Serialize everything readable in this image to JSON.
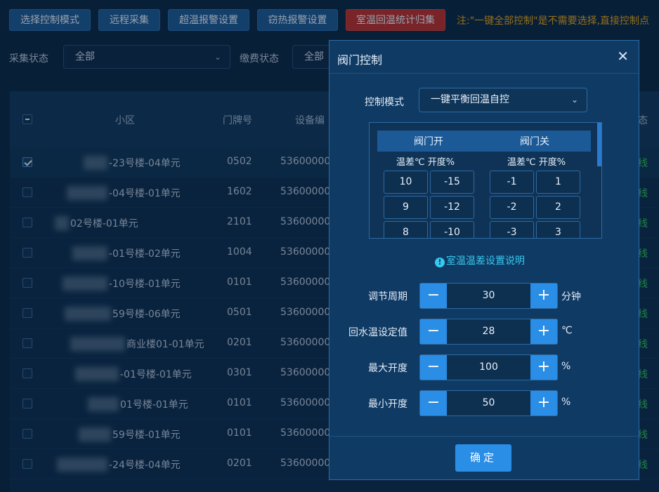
{
  "toolbar": {
    "buttons": [
      {
        "label": "选择控制模式"
      },
      {
        "label": "远程采集"
      },
      {
        "label": "超温报警设置"
      },
      {
        "label": "窃热报警设置"
      },
      {
        "label": "室温回温统计归集"
      }
    ],
    "note": "注:\"一键全部控制\"是不需要选择,直接控制点"
  },
  "filters": {
    "collect_label": "采集状态",
    "collect_value": "全部",
    "pay_label": "缴费状态",
    "pay_value": "全部"
  },
  "table": {
    "headers": {
      "community": "小区",
      "door": "门牌号",
      "device": "设备编",
      "status": "态"
    },
    "rows": [
      {
        "community": "-23号楼-04单元",
        "door": "0502",
        "device": "53600000",
        "status": "线",
        "checked": true
      },
      {
        "community": "-04号楼-01单元",
        "door": "1602",
        "device": "53600000",
        "status": "线",
        "checked": false
      },
      {
        "community": "02号楼-01单元",
        "door": "2101",
        "device": "53600000",
        "status": "线",
        "checked": false
      },
      {
        "community": "-01号楼-02单元",
        "door": "1004",
        "device": "53600000",
        "status": "线",
        "checked": false
      },
      {
        "community": "-10号楼-01单元",
        "door": "0101",
        "device": "53600000",
        "status": "线",
        "checked": false
      },
      {
        "community": "59号楼-06单元",
        "door": "0501",
        "device": "53600000",
        "status": "线",
        "checked": false
      },
      {
        "community": "商业楼01-01单元",
        "door": "0201",
        "device": "53600000",
        "status": "线",
        "checked": false
      },
      {
        "community": "-01号楼-01单元",
        "door": "0301",
        "device": "53600000",
        "status": "线",
        "checked": false
      },
      {
        "community": "01号楼-01单元",
        "door": "0101",
        "device": "53600000",
        "status": "线",
        "checked": false
      },
      {
        "community": "59号楼-01单元",
        "door": "0101",
        "device": "53600000",
        "status": "线",
        "checked": false
      },
      {
        "community": "-24号楼-04单元",
        "door": "0201",
        "device": "53600000",
        "status": "线",
        "checked": false
      }
    ]
  },
  "dialog": {
    "title": "阀门控制",
    "close_glyph": "✕",
    "mode_label": "控制模式",
    "mode_value": "一键平衡回温自控",
    "valve_table": {
      "open_header": "阀门开",
      "close_header": "阀门关",
      "open_sub": "温差℃ 开度%",
      "close_sub": "温差℃ 开度%",
      "open_rows": [
        [
          "10",
          "-15"
        ],
        [
          "9",
          "-12"
        ],
        [
          "8",
          "-10"
        ]
      ],
      "close_rows": [
        [
          "-1",
          "1"
        ],
        [
          "-2",
          "2"
        ],
        [
          "-3",
          "3"
        ]
      ]
    },
    "hint_icon": "!",
    "hint": "室温温差设置说明",
    "settings": [
      {
        "label": "调节周期",
        "value": "30",
        "unit": "分钟"
      },
      {
        "label": "回水温设定值",
        "value": "28",
        "unit": "℃"
      },
      {
        "label": "最大开度",
        "value": "100",
        "unit": "%"
      },
      {
        "label": "最小开度",
        "value": "50",
        "unit": "%"
      }
    ],
    "minus_glyph": "−",
    "plus_glyph": "+",
    "ok_label": "确定"
  },
  "icons": {
    "chevron": "chevron-down-icon",
    "close": "close-icon",
    "info": "info-icon"
  },
  "colors": {
    "accent": "#2a8ee6",
    "danger": "#b8302e",
    "warning": "#e1a41a",
    "online": "#2fc25b",
    "hint": "#37c8ee"
  }
}
